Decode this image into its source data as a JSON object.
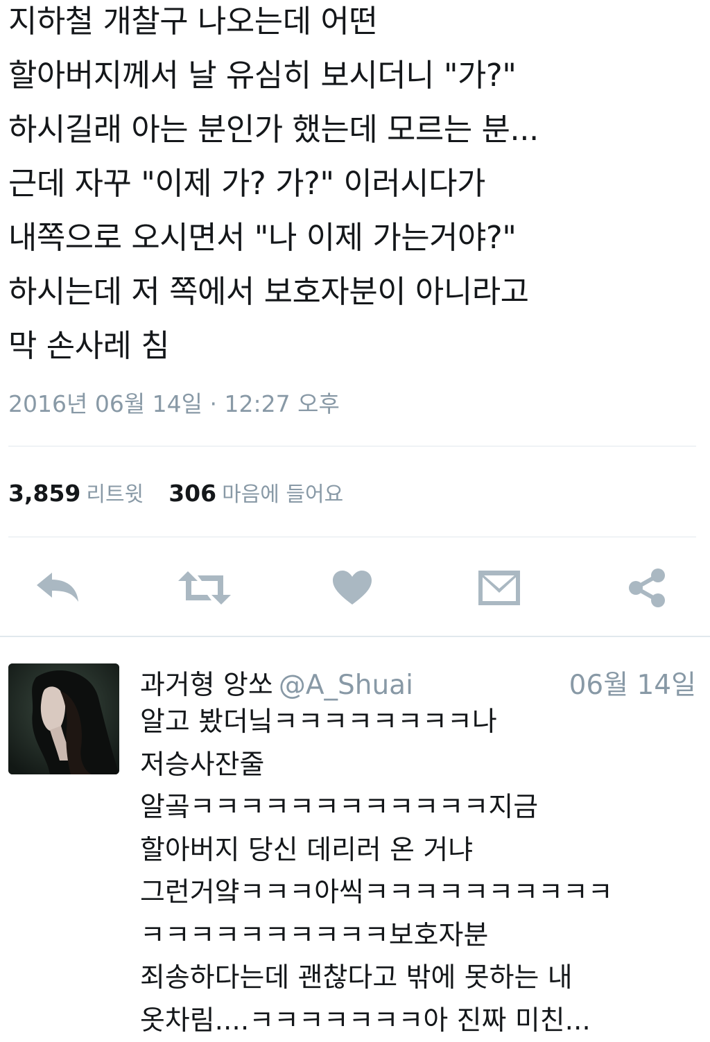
{
  "tweet": {
    "lines": [
      "지하철 개찰구 나오는데 어떤",
      "할아버지께서 날 유심히 보시더니 \"가?\"",
      "하시길래 아는 분인가 했는데 모르는 분...",
      "근데 자꾸 \"이제 가? 가?\" 이러시다가",
      "내쪽으로 오시면서 \"나 이제 가는거야?\"",
      "하시는데 저 쪽에서 보호자분이 아니라고",
      "막 손사레 침"
    ],
    "timestamp": "2016년 06월 14일 · 12:27 오후",
    "retweet_count": "3,859",
    "retweet_label": "리트윗",
    "like_count": "306",
    "like_label": "마음에 들어요"
  },
  "actions": {
    "icons": [
      "reply-icon",
      "retweet-icon",
      "heart-icon",
      "message-icon",
      "share-icon"
    ],
    "color": "#aab8c2"
  },
  "reply": {
    "name": "과거형 앙쏘",
    "handle": "@A_Shuai",
    "date": "06월 14일",
    "lines": [
      "알고 봤더닠ㅋㅋㅋㅋㅋㅋㅋㅋ나",
      "저승사잔줄",
      "알곸ㅋㅋㅋㅋㅋㅋㅋㅋㅋㅋㅋㅋ지금",
      "할아버지 당신 데리러 온 거냐",
      "그런거얔ㅋㅋㅋ아씩ㅋㅋㅋㅋㅋㅋㅋㅋㅋㅋ",
      "ㅋㅋㅋㅋㅋㅋㅋㅋㅋㅋ보호자분",
      "죄송하다는데 괜찮다고 밖에 못하는 내",
      "옷차림....ㅋㅋㅋㅋㅋㅋㅋ아 진짜 미친..."
    ]
  }
}
